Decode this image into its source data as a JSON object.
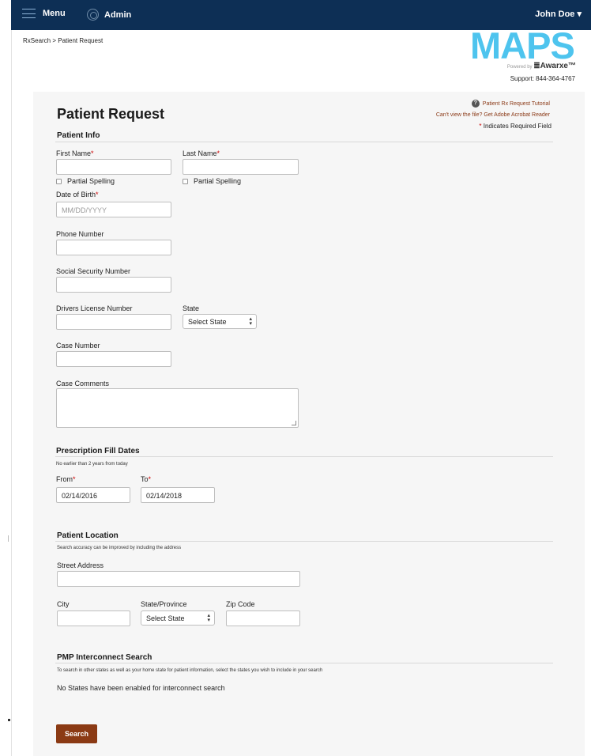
{
  "topbar": {
    "menu_label": "Menu",
    "admin_label": "Admin",
    "user_label": "John Doe ▾"
  },
  "breadcrumb": "RxSearch > Patient Request",
  "logo": {
    "text": "MAPS",
    "powered_by": "Powered by",
    "brand": "≣Awarxe™"
  },
  "support": "Support: 844-364-4767",
  "page_title": "Patient Request",
  "links": {
    "tutorial": "Patient Rx Request Tutorial",
    "adobe": "Can't view the file? Get Adobe Acrobat Reader"
  },
  "required_note": "Indicates Required Field",
  "required_mark": "*",
  "patient_info": {
    "title": "Patient Info",
    "first_name_label": "First Name",
    "last_name_label": "Last Name",
    "partial_spelling_label": "Partial Spelling",
    "dob_label": "Date of Birth",
    "dob_placeholder": "MM/DD/YYYY",
    "phone_label": "Phone Number",
    "ssn_label": "Social Security Number",
    "dl_label": "Drivers License Number",
    "state_label": "State",
    "state_value": "Select State",
    "case_number_label": "Case Number",
    "case_comments_label": "Case Comments"
  },
  "fill_dates": {
    "title": "Prescription Fill Dates",
    "note": "No earlier than 2 years from today",
    "from_label": "From",
    "from_value": "02/14/2016",
    "to_label": "To",
    "to_value": "02/14/2018"
  },
  "location": {
    "title": "Patient Location",
    "note": "Search accuracy can be improved by including the address",
    "street_label": "Street Address",
    "city_label": "City",
    "province_label": "State/Province",
    "province_value": "Select State",
    "zip_label": "Zip Code"
  },
  "interconnect": {
    "title": "PMP Interconnect Search",
    "note": "To search in other states as well as your home state for patient information, select the states you wish to include in your search",
    "message": "No States have been enabled for interconnect search"
  },
  "search_button": "Search",
  "colors": {
    "header": "#0d2f55",
    "accent": "#8b3a14",
    "logo": "#4ec4ee",
    "required": "#cc0000"
  }
}
